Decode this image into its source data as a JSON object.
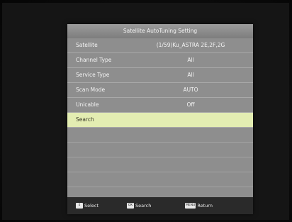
{
  "dialog": {
    "title": "Satellite AutoTuning Setting"
  },
  "settings": [
    {
      "label": "Satellite",
      "value": "(1/59)Ku_ASTRA 2E,2F,2G"
    },
    {
      "label": "Channel Type",
      "value": "All"
    },
    {
      "label": "Service Type",
      "value": "All"
    },
    {
      "label": "Scan Mode",
      "value": "AUTO"
    },
    {
      "label": "Unicable",
      "value": "Off"
    }
  ],
  "search_item": {
    "label": "Search"
  },
  "footer": {
    "select": {
      "key": "⇕",
      "label": "Select"
    },
    "search": {
      "key": "OK",
      "label": "Search"
    },
    "return": {
      "key": "MENU",
      "label": "Return"
    }
  }
}
